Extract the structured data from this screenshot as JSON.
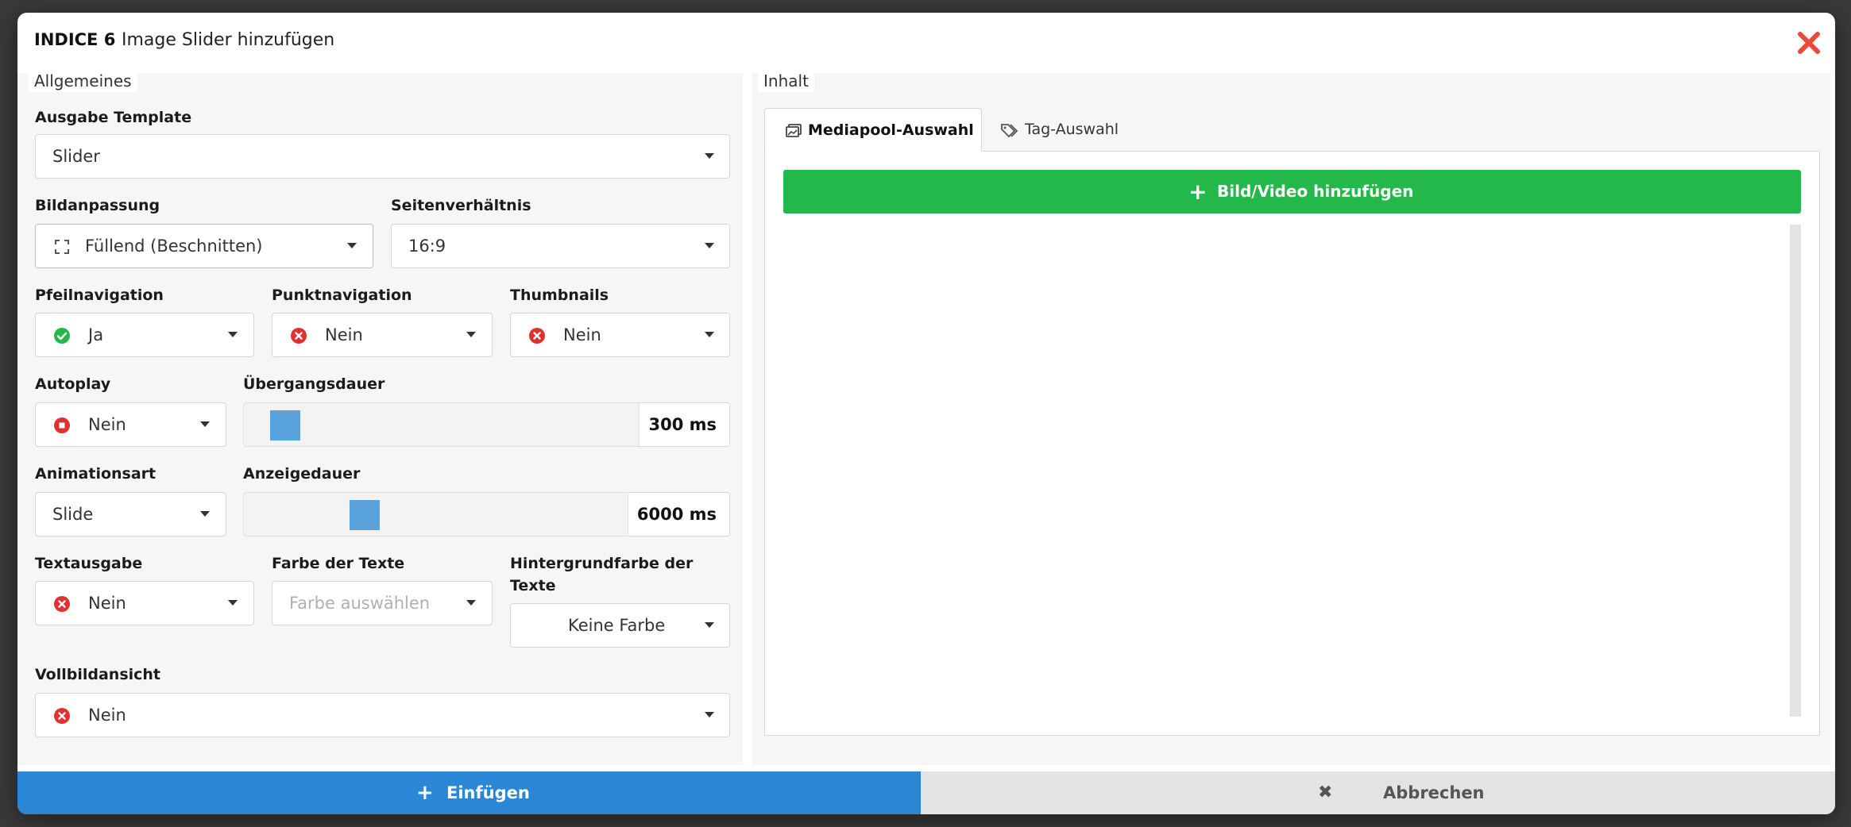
{
  "header": {
    "code": "INDICE 6",
    "title": "Image Slider hinzufügen"
  },
  "general": {
    "legend": "Allgemeines",
    "output_template": {
      "label": "Ausgabe Template",
      "value": "Slider"
    },
    "image_fit": {
      "label": "Bildanpassung",
      "value": "Füllend (Beschnitten)",
      "icon": "expand-icon"
    },
    "aspect_ratio": {
      "label": "Seitenverhältnis",
      "value": "16:9"
    },
    "arrow_nav": {
      "label": "Pfeilnavigation",
      "value": "Ja",
      "icon": "check-circle-icon"
    },
    "dot_nav": {
      "label": "Punktnavigation",
      "value": "Nein",
      "icon": "x-circle-icon"
    },
    "thumbnails": {
      "label": "Thumbnails",
      "value": "Nein",
      "icon": "x-circle-icon"
    },
    "autoplay": {
      "label": "Autoplay",
      "value": "Nein",
      "icon": "stop-circle-icon"
    },
    "transition": {
      "label": "Übergangsdauer",
      "value": "300 ms",
      "level": 0.04
    },
    "animation": {
      "label": "Animationsart",
      "value": "Slide"
    },
    "display_duration": {
      "label": "Anzeigedauer",
      "value": "6000 ms",
      "level": 0.27
    },
    "text_output": {
      "label": "Textausgabe",
      "value": "Nein",
      "icon": "x-circle-icon"
    },
    "text_color": {
      "label": "Farbe der Texte",
      "placeholder": "Farbe auswählen"
    },
    "text_bg_color": {
      "label": "Hintergrundfarbe der Texte",
      "value": "Keine Farbe"
    },
    "fullscreen": {
      "label": "Vollbildansicht",
      "value": "Nein",
      "icon": "x-circle-icon"
    }
  },
  "content": {
    "legend": "Inhalt",
    "tabs": [
      {
        "label": "Mediapool-Auswahl",
        "icon": "images-icon",
        "active": true
      },
      {
        "label": "Tag-Auswahl",
        "icon": "tags-icon",
        "active": false
      }
    ],
    "add_button": "Bild/Video hinzufügen"
  },
  "footer": {
    "insert": "Einfügen",
    "cancel": "Abbrechen"
  },
  "colors": {
    "primary": "#2b86d6",
    "success": "#24b84a",
    "danger": "#e03131",
    "slider_handle": "#5aa2dc"
  }
}
